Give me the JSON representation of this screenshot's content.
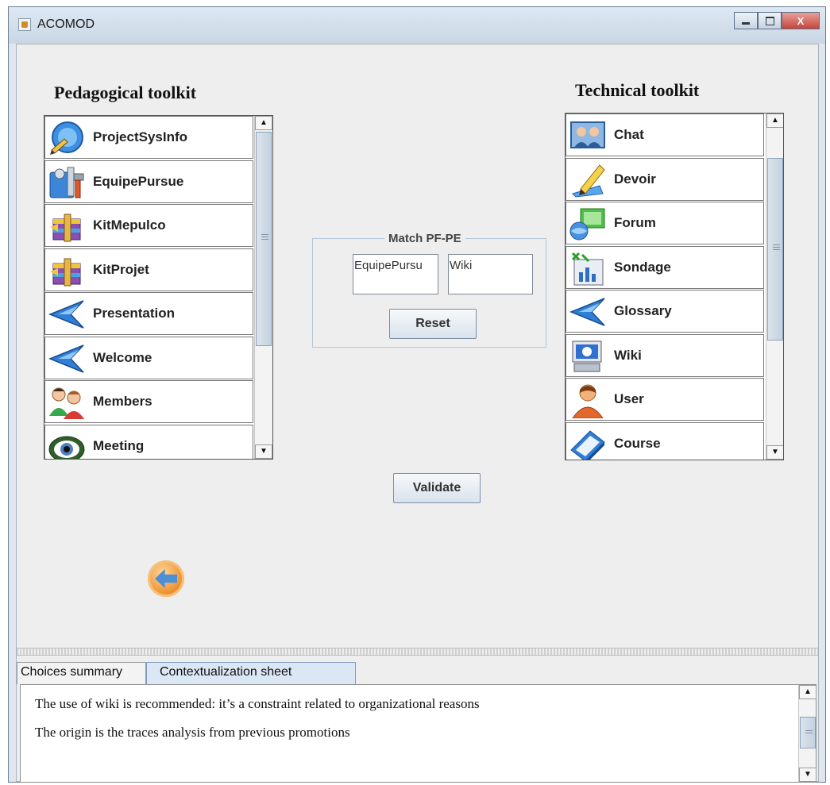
{
  "window": {
    "title": "ACOMOD",
    "icon": "java-app-icon"
  },
  "caption_buttons": [
    {
      "name": "minimize-button",
      "icon": "minimize-icon"
    },
    {
      "name": "maximize-button",
      "icon": "maximize-icon"
    },
    {
      "name": "close-button",
      "icon": "close-icon",
      "label": "X"
    }
  ],
  "pedagogical": {
    "title": "Pedagogical toolkit",
    "items": [
      {
        "label": "ProjectSysInfo",
        "icon": "globe-pen-icon"
      },
      {
        "label": "EquipePursue",
        "icon": "tools-icon"
      },
      {
        "label": "KitMepulco",
        "icon": "archive-box-icon"
      },
      {
        "label": "KitProjet",
        "icon": "archive-box-icon"
      },
      {
        "label": "Presentation",
        "icon": "blue-arrow-icon"
      },
      {
        "label": "Welcome",
        "icon": "blue-arrow-icon"
      },
      {
        "label": "Members",
        "icon": "members-icon"
      },
      {
        "label": "Meeting",
        "icon": "eye-icon"
      }
    ]
  },
  "technical": {
    "title": "Technical toolkit",
    "items": [
      {
        "label": "Chat",
        "icon": "chat-icon"
      },
      {
        "label": "Devoir",
        "icon": "pencil-icon"
      },
      {
        "label": "Forum",
        "icon": "forum-icon"
      },
      {
        "label": "Sondage",
        "icon": "poll-icon"
      },
      {
        "label": "Glossary",
        "icon": "blue-arrow-icon"
      },
      {
        "label": "Wiki",
        "icon": "wiki-icon"
      },
      {
        "label": "User",
        "icon": "user-icon"
      },
      {
        "label": "Course",
        "icon": "course-book-icon"
      }
    ]
  },
  "match": {
    "legend": "Match PF-PE",
    "field_pf": "EquipePursu",
    "field_pe": "Wiki",
    "reset_label": "Reset"
  },
  "validate_label": "Validate",
  "back_icon": "back-arrow-icon",
  "tabs": [
    "Choices summary",
    "Contextualization sheet"
  ],
  "active_tab": "Contextualization sheet",
  "sheet_text": [
    "The use of wiki is recommended: it’s a constraint related to organizational reasons",
    "The origin is the traces analysis from previous promotions"
  ],
  "colors": {
    "tab_active": "#dbe7f4",
    "button_gradient_end": "#d9e2ec",
    "arrow_blue": "#4d8fd6",
    "back_orange": "#ea8b24"
  }
}
